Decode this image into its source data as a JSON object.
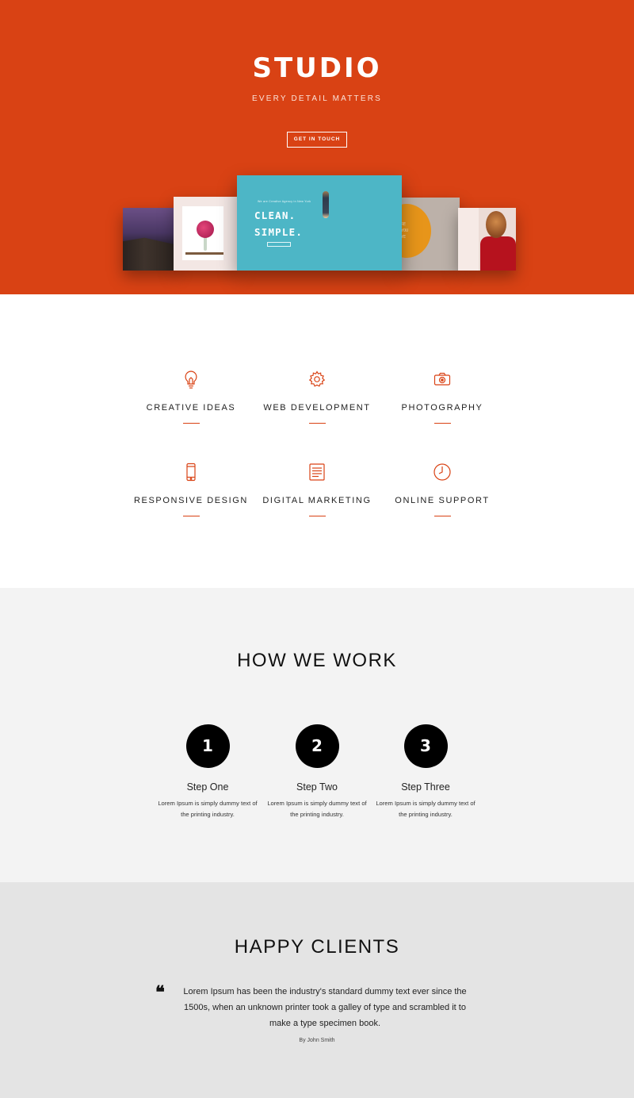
{
  "hero": {
    "title": "STUDIO",
    "subtitle": "EVERY DETAIL MATTERS",
    "cta_label": "GET IN TOUCH",
    "background_color": "#d94214",
    "mockup": {
      "small_text": "We are Creative Agency in New York",
      "headline_line1": "CLEAN.",
      "headline_line2": "SIMPLE.",
      "side_card_text": [
        "RE",
        "YOU",
        "YE"
      ]
    }
  },
  "services": {
    "accent_color": "#d94214",
    "items": [
      {
        "label": "CREATIVE IDEAS",
        "icon": "lightbulb-icon"
      },
      {
        "label": "WEB DEVELOPMENT",
        "icon": "gear-icon"
      },
      {
        "label": "PHOTOGRAPHY",
        "icon": "camera-icon"
      },
      {
        "label": "RESPONSIVE DESIGN",
        "icon": "smartphone-icon"
      },
      {
        "label": "DIGITAL MARKETING",
        "icon": "document-icon"
      },
      {
        "label": "ONLINE SUPPORT",
        "icon": "clock-icon"
      }
    ]
  },
  "how": {
    "title": "HOW WE WORK",
    "steps": [
      {
        "number": "1",
        "title": "Step One",
        "desc_line1": "Lorem Ipsum is simply dummy text of",
        "desc_line2": "the printing industry."
      },
      {
        "number": "2",
        "title": "Step Two",
        "desc_line1": "Lorem Ipsum is simply dummy text of",
        "desc_line2": "the printing industry."
      },
      {
        "number": "3",
        "title": "Step Three",
        "desc_line1": "Lorem Ipsum is simply dummy text of",
        "desc_line2": "the printing industry."
      }
    ]
  },
  "clients": {
    "title": "HAPPY CLIENTS",
    "quote_mark": "❝",
    "quote": "Lorem Ipsum has been the industry's standard dummy text ever since the 1500s, when an unknown printer took a galley of type and scrambled it to make a type specimen book.",
    "author": "By John Smith"
  }
}
